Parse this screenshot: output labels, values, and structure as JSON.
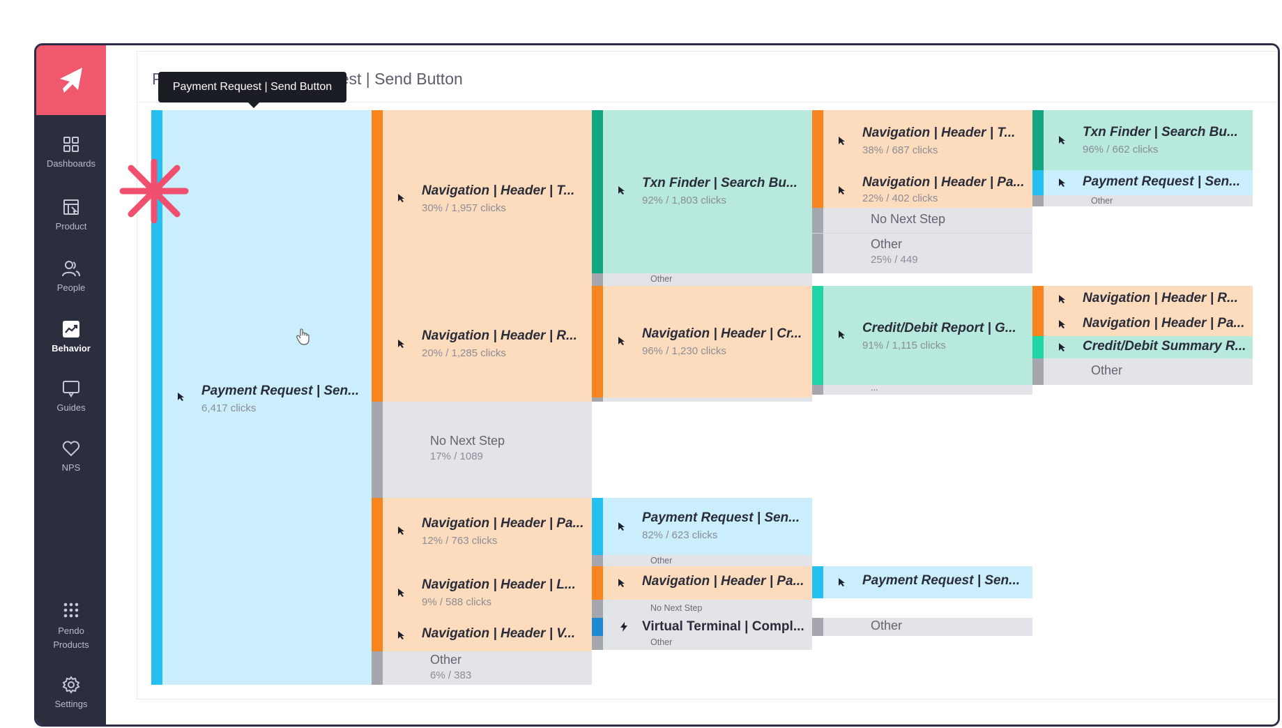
{
  "sidebar": {
    "items": [
      {
        "label": "Dashboards",
        "icon": "dashboards-icon"
      },
      {
        "label": "Product",
        "icon": "product-icon"
      },
      {
        "label": "People",
        "icon": "people-icon"
      },
      {
        "label": "Behavior",
        "icon": "behavior-icon",
        "active": true
      },
      {
        "label": "Guides",
        "icon": "guides-icon"
      },
      {
        "label": "NPS",
        "icon": "heart-icon"
      },
      {
        "label": "Pendo Products",
        "icon": "apps-grid-icon"
      },
      {
        "label": "Settings",
        "icon": "gear-icon"
      }
    ]
  },
  "page": {
    "title": "Paths from Payment Request | Send Button",
    "tooltip": "Payment Request | Send Button"
  },
  "colors": {
    "brand": "#f0586d",
    "sidebar": "#2b2e3d",
    "step_blue": "#25c0f1",
    "step_orange": "#f7841e",
    "step_green": "#12a682",
    "step_mint": "#1fd4a6",
    "other_gray": "#a6a7ae"
  },
  "paths": {
    "root": {
      "label": "Payment Request | Sen...",
      "stat": "6,417 clicks"
    },
    "col1": [
      {
        "label": "Navigation | Header | T...",
        "stat": "30% / 1,957 clicks"
      },
      {
        "label": "Navigation | Header | R...",
        "stat": "20% / 1,285 clicks"
      },
      {
        "label": "No Next Step",
        "stat": "17% / 1089"
      },
      {
        "label": "Navigation | Header | Pa...",
        "stat": "12% / 763 clicks"
      },
      {
        "label": "Navigation | Header | L...",
        "stat": "9% / 588 clicks"
      },
      {
        "label": "Navigation | Header | V..."
      },
      {
        "label": "Other",
        "stat": "6% / 383"
      }
    ],
    "col2": [
      {
        "label": "Txn Finder | Search Bu...",
        "stat": "92% / 1,803 clicks",
        "other": "Other"
      },
      {
        "label": "Navigation | Header | Cr...",
        "stat": "96% / 1,230 clicks"
      },
      {
        "label": "Payment Request | Sen...",
        "stat": "82% / 623 clicks",
        "other": "Other"
      },
      {
        "label": "Navigation | Header | Pa...",
        "other": "No Next Step"
      },
      {
        "label": "Virtual Terminal | Compl...",
        "other": "Other"
      }
    ],
    "col3": [
      {
        "label": "Navigation | Header | T...",
        "stat": "38% / 687 clicks"
      },
      {
        "label": "Navigation | Header | Pa...",
        "stat": "22% / 402 clicks"
      },
      {
        "label": "No Next Step"
      },
      {
        "label": "Other",
        "stat": "25% / 449"
      },
      {
        "label": "Credit/Debit Report | G...",
        "stat": "91% / 1,115 clicks",
        "other": "..."
      },
      {
        "label": "Payment Request | Sen..."
      },
      {
        "label": "Other"
      }
    ],
    "col4": [
      {
        "label": "Txn Finder | Search Bu...",
        "stat": "96% / 662 clicks"
      },
      {
        "label": "Payment Request | Sen...",
        "other": "Other"
      },
      {
        "label": "Navigation | Header | R..."
      },
      {
        "label": "Navigation | Header | Pa..."
      },
      {
        "label": "Credit/Debit Summary R..."
      },
      {
        "label": "Other"
      }
    ]
  }
}
